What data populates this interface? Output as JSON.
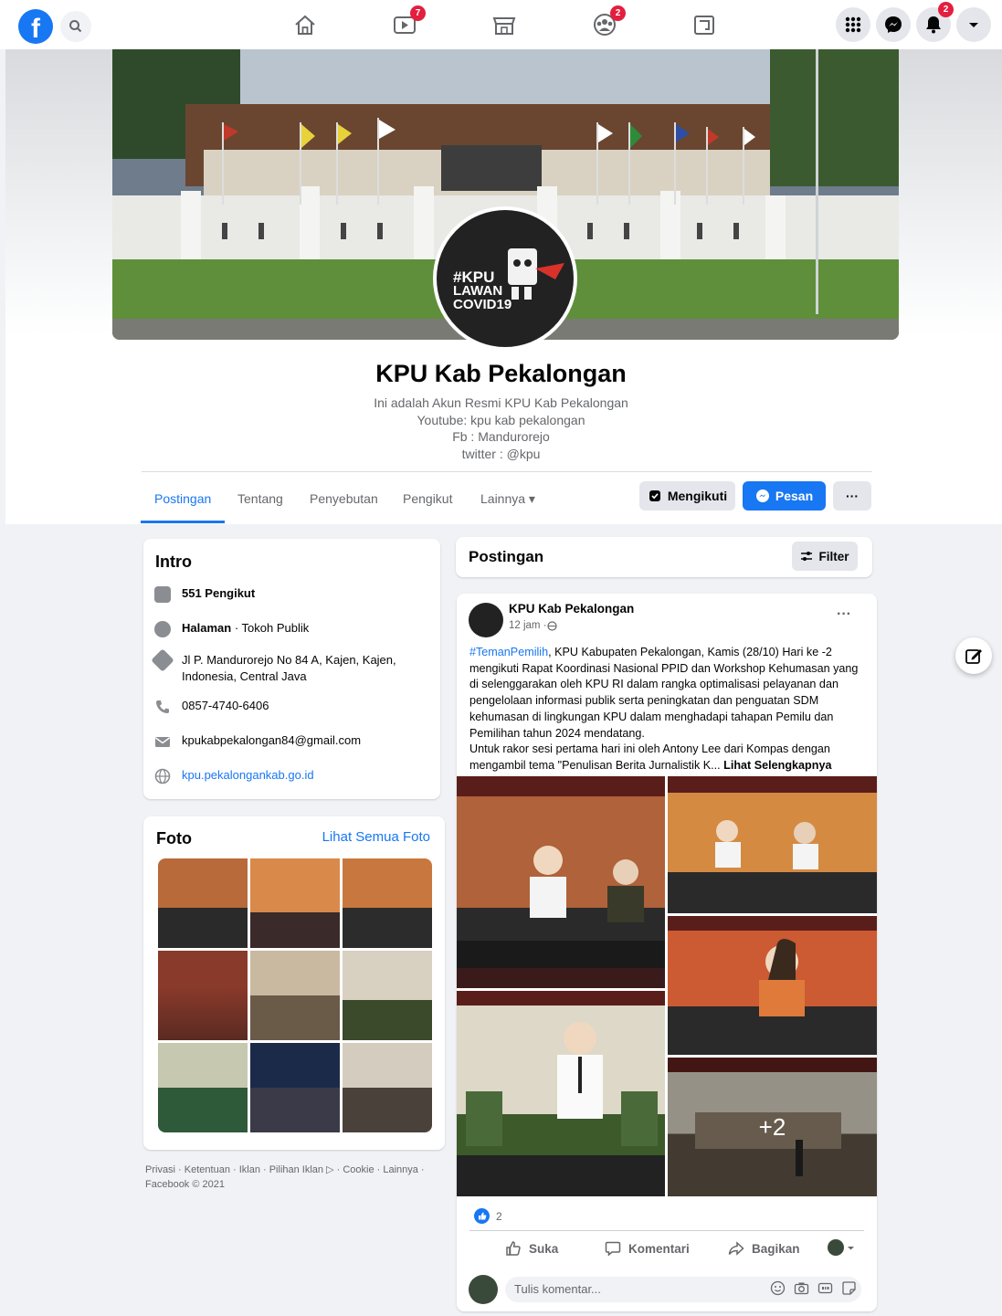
{
  "topnav": {
    "logo_letter": "f",
    "badges": {
      "video": "7",
      "groups": "2",
      "notifications": "2"
    }
  },
  "profile": {
    "name": "KPU Kab Pekalongan",
    "avatar_text": [
      "#KPU",
      "LAWAN",
      "COVID19"
    ],
    "bio_lines": [
      "Ini adalah Akun Resmi KPU Kab Pekalongan",
      "Youtube: kpu kab pekalongan",
      "Fb : Mandurorejo",
      "twitter : @kpu"
    ]
  },
  "tabs": [
    {
      "label": "Postingan"
    },
    {
      "label": "Tentang"
    },
    {
      "label": "Penyebutan"
    },
    {
      "label": "Pengikut"
    },
    {
      "label": "Lainnya ▾"
    }
  ],
  "actions": {
    "following_label": "Mengikuti",
    "message_label": "Pesan",
    "more_label": "···"
  },
  "intro": {
    "title": "Intro",
    "followers": "551 Pengikut",
    "page_type_bold": "Halaman",
    "page_type_rest": " · Tokoh Publik",
    "address": "Jl P. Mandurorejo No 84 A, Kajen, Kajen, Indonesia, Central Java",
    "phone": "0857-4740-6406",
    "email": "kpukabpekalongan84@gmail.com",
    "website": "kpu.pekalongankab.go.id"
  },
  "photos": {
    "title": "Foto",
    "see_all": "Lihat Semua Foto"
  },
  "footer": "Privasi · Ketentuan · Iklan · Pilihan Iklan ▷ · Cookie · Lainnya · Facebook © 2021",
  "posts_header": {
    "title": "Postingan",
    "filter_label": "Filter"
  },
  "post": {
    "author": "KPU Kab Pekalongan",
    "time": "12 jam · ",
    "hashtag": "#TemanPemilih",
    "text": ", KPU Kabupaten Pekalongan, Kamis (28/10) Hari ke -2 mengikuti Rapat Koordinasi Nasional PPID dan Workshop Kehumasan yang di selenggarakan oleh KPU RI dalam rangka optimalisasi pelayanan dan pengelolaan informasi publik serta peningkatan dan penguatan SDM kehumasan di lingkungan KPU dalam menghadapi tahapan Pemilu dan Pemilihan tahun 2024 mendatang.",
    "text2": "Untuk rakor sesi pertama hari ini oleh Antony Lee dari Kompas dengan mengambil tema \"Penulisan Berita Jurnalistik K...",
    "see_more": "Lihat Selengkapnya",
    "extra_photos": "+2",
    "likes": "2",
    "like_label": "Suka",
    "comment_label": "Komentari",
    "share_label": "Bagikan",
    "comment_placeholder": "Tulis komentar..."
  }
}
